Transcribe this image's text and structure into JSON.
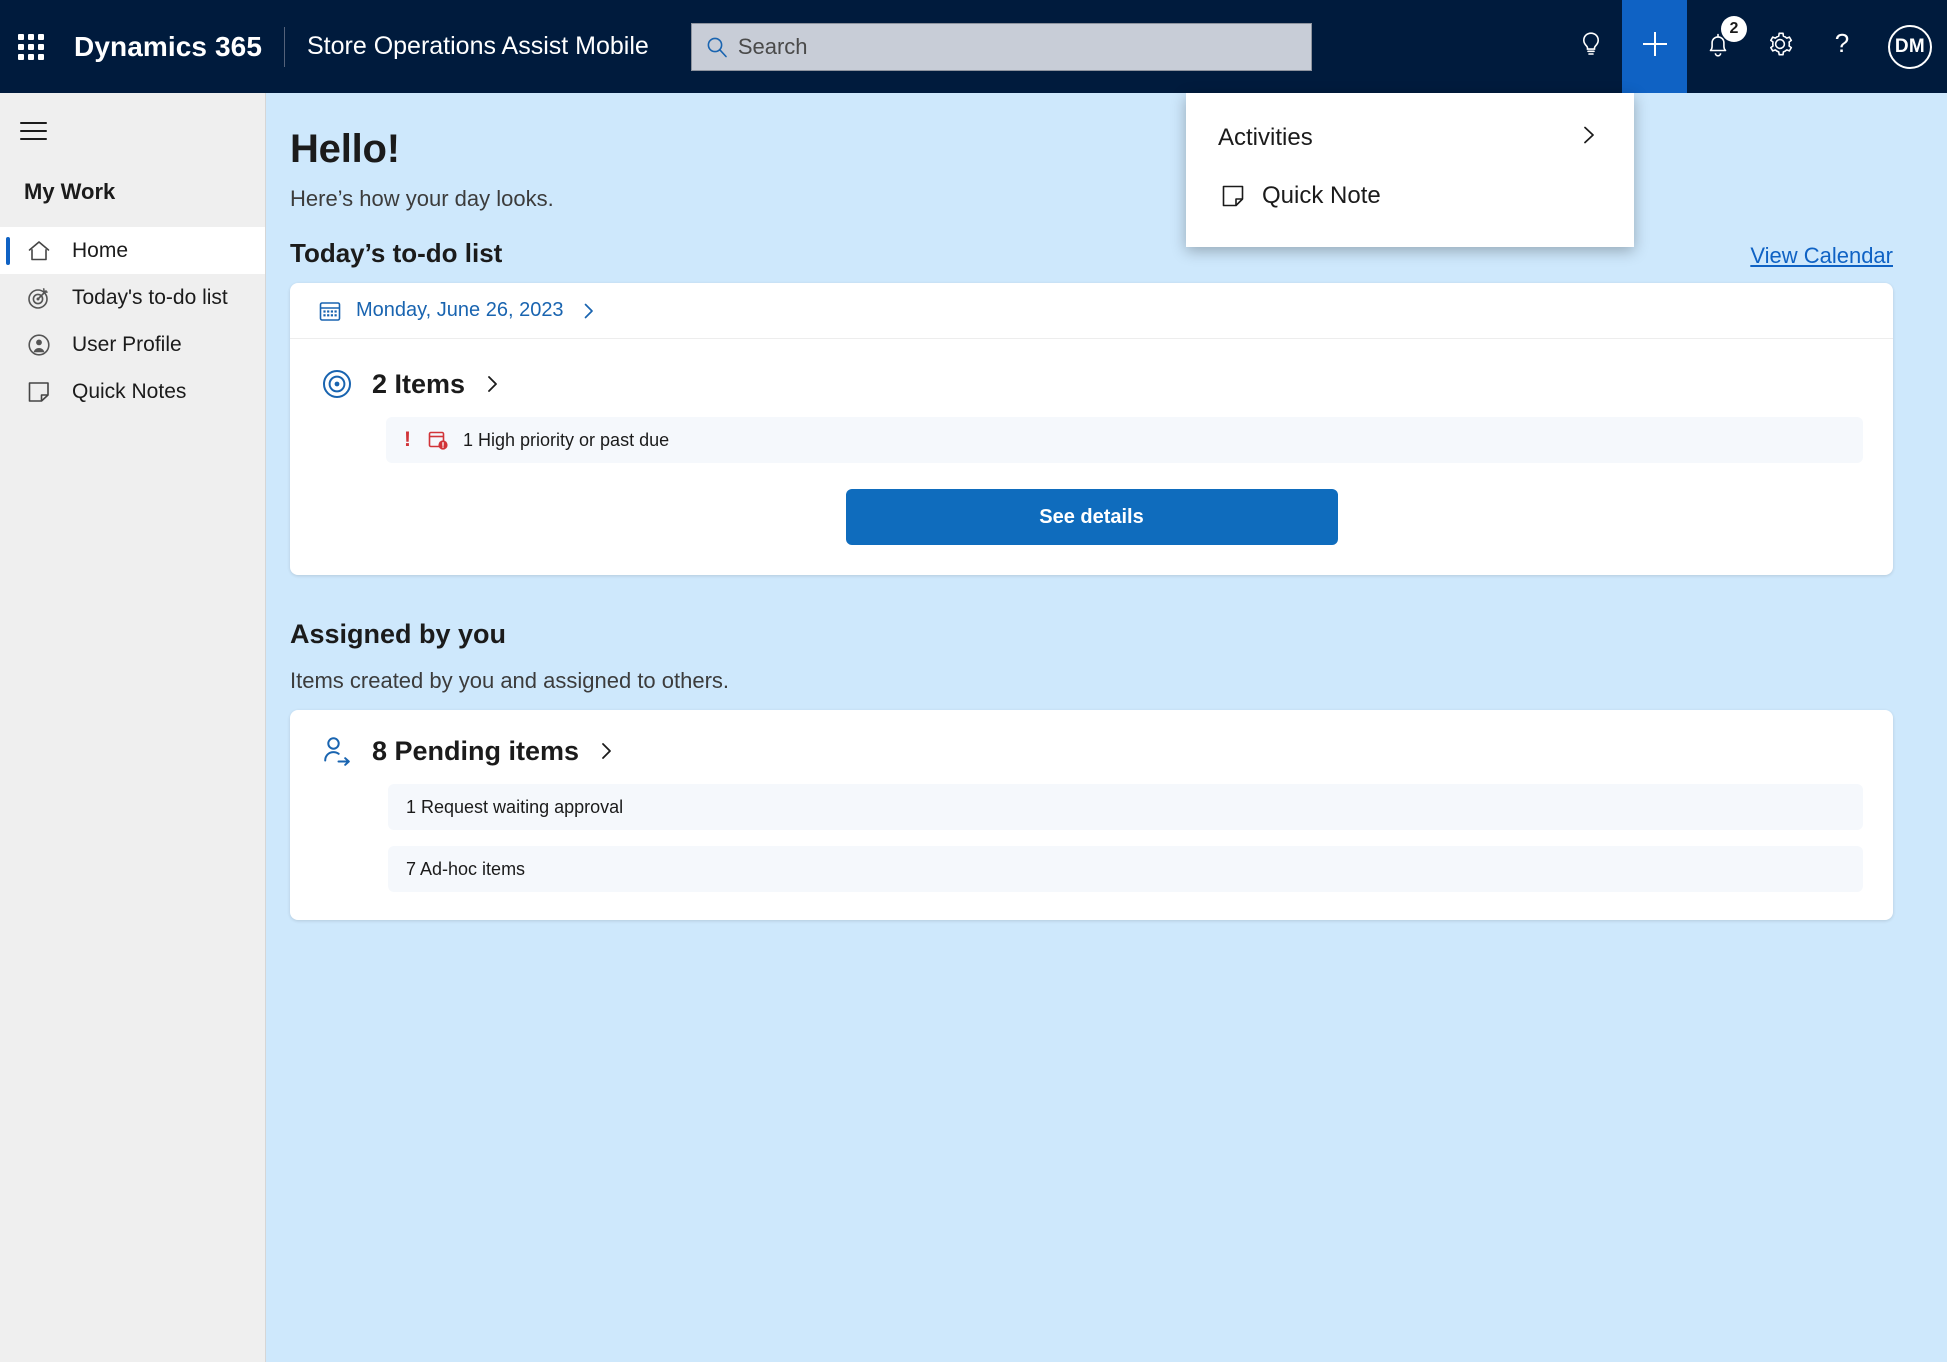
{
  "topnav": {
    "waffle_name": "app-launcher",
    "brand": "Dynamics 365",
    "app_name": "Store Operations Assist Mobile",
    "search_placeholder": "Search",
    "search_value": "",
    "notification_count": "2",
    "avatar_initials": "DM"
  },
  "flyout": {
    "items": [
      {
        "label": "Activities",
        "icon": "",
        "has_chevron": true
      },
      {
        "label": "Quick Note",
        "icon": "note-icon",
        "has_chevron": false
      }
    ]
  },
  "sidebar": {
    "group_title": "My Work",
    "items": [
      {
        "label": "Home",
        "icon": "home-icon",
        "active": true
      },
      {
        "label": "Today's to-do list",
        "icon": "target-icon",
        "active": false
      },
      {
        "label": "User Profile",
        "icon": "person-circle-icon",
        "active": false
      },
      {
        "label": "Quick Notes",
        "icon": "note-icon",
        "active": false
      }
    ]
  },
  "main": {
    "greeting": "Hello!",
    "greeting_sub": "Here’s how your day looks.",
    "todo": {
      "title": "Today’s to-do list",
      "view_calendar": "View Calendar",
      "date": "Monday, June 26, 2023",
      "count_label": "2 Items",
      "alert_text": "1 High priority or past due",
      "alert_bang": "!",
      "see_details": "See details"
    },
    "assigned": {
      "title": "Assigned by you",
      "subtitle": "Items created by you and assigned to others.",
      "count_label": "8 Pending items",
      "rows": [
        "1 Request waiting approval",
        "7 Ad-hoc items"
      ]
    }
  },
  "colors": {
    "nav_bg": "#001b3d",
    "accent": "#0f62c4",
    "main_bg": "#cee8fc",
    "sidebar_bg": "#efefef",
    "alert_red": "#d13438",
    "button_blue": "#0f6cbd"
  }
}
